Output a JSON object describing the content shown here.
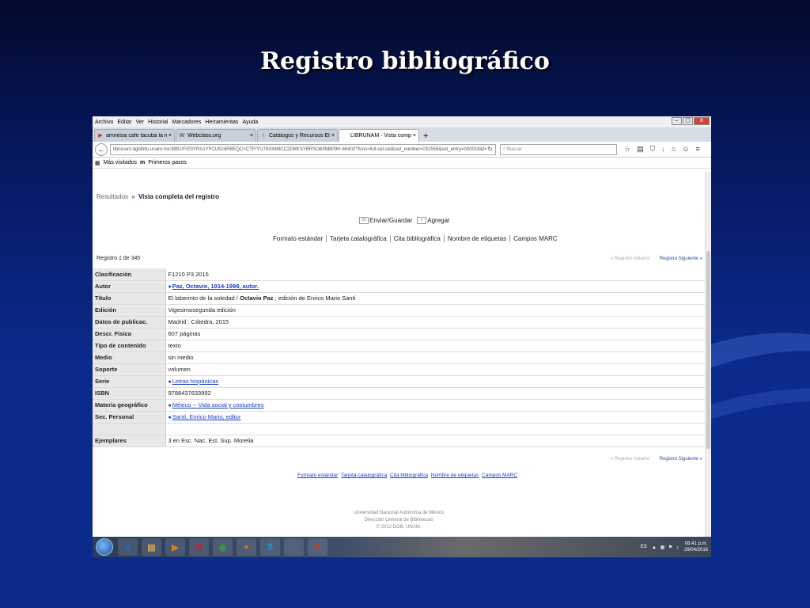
{
  "slide": {
    "title": "Registro bibliográfico"
  },
  "window": {
    "menu": [
      "Archivo",
      "Editar",
      "Ver",
      "Historial",
      "Marcadores",
      "Herramientas",
      "Ayuda"
    ],
    "controls": {
      "minimize": "–",
      "restore": "▢",
      "close": "X"
    }
  },
  "tabs": [
    {
      "icon": "▶",
      "label": "amnesia cafe tacuba la mal...",
      "close": "×",
      "color": "#d62b1f"
    },
    {
      "icon": "W",
      "label": "Webclass.org",
      "close": "×",
      "color": "#333333"
    },
    {
      "icon": "i",
      "label": "Catálogos y Recursos Elect...",
      "close": "×",
      "color": "#2a62b8"
    },
    {
      "icon": "",
      "label": "LIBRUNAM - Vista completa de...",
      "close": "×",
      "color": "#333333"
    }
  ],
  "newtab": "+",
  "nav": {
    "back": "←",
    "url": "librunam.dgbiblio.unam.mx:8991/F/P3YRA1YFCU524RBEQC<CTF/YU78XINMCC2DRKSYBRSO63NBP9H-46402?func=full-set-set&set_number=032558&set_entry=000018&f=",
    "reload": "↻",
    "search_placeholder": "Buscar",
    "icons": [
      "☆",
      "▤",
      "⛉",
      "↓",
      "⌂",
      "☺",
      "≡"
    ]
  },
  "bookmarks": {
    "visited": "Más visitados",
    "first": "Primeros pasos"
  },
  "page": {
    "breadcrumb": {
      "results": "Resultados",
      "sep": "»",
      "current": "Vista completa del registro"
    },
    "actions": {
      "send": "Enviar/Guardar",
      "add": "Agregar"
    },
    "formats": [
      "Formato estándar",
      "Tarjeta catalográfica",
      "Cita bibliográfica",
      "Nombre de etiquetas",
      "Campos MARC"
    ],
    "record_count": "Registro 1 de 345",
    "prev_label": "Registro Anterior",
    "next_label": "Registro Siguiente",
    "records": [
      {
        "key": "Clasificación",
        "value": "F1210 P3 2015"
      },
      {
        "key": "Autor",
        "value": "Paz, Octavio, 1914-1998, autor.",
        "link": true,
        "bold": true,
        "dot": true
      },
      {
        "key": "Título",
        "value_pre": "El laberinto de la soledad / ",
        "value_bold": "Octavio Paz",
        "value_post": " ; edición de Enrico Mario Santí"
      },
      {
        "key": "Edición",
        "value": "Vigesimosegunda edición"
      },
      {
        "key": "Datos de publicac.",
        "value": "Madrid : Cátedra, 2015"
      },
      {
        "key": "Descr. Física",
        "value": "607 páginas"
      },
      {
        "key": "Tipo de contenido",
        "value": "texto"
      },
      {
        "key": "Medio",
        "value": "sin medio"
      },
      {
        "key": "Soporte",
        "value": "volumen"
      },
      {
        "key": "Serie",
        "value": "Letras hispánicas",
        "link": true,
        "dot": true
      },
      {
        "key": "ISBN",
        "value": "9788437633992"
      },
      {
        "key": "Materia geográfico",
        "value": "México -- Vida social y costumbres",
        "link": true,
        "dot": true
      },
      {
        "key": "Sec. Personal",
        "value": "Santí, Enrico Mario, editor",
        "link": true,
        "dot": true
      },
      {
        "key": "",
        "value": ""
      },
      {
        "key": "Ejemplares",
        "value": "3 en  Esc. Nac. Est. Sup. Morelia"
      }
    ],
    "bottom_links": [
      "Formato estándar",
      "Tarjeta catalográfica",
      "Cita bibliográfica",
      "Nombre de etiquetas",
      "Campos MARC"
    ],
    "footer": [
      "Universidad Nacional Autónoma de México",
      "Dirección General de Bibliotecas",
      "© 2012 DGB, UNAM."
    ]
  },
  "taskbar": {
    "apps": [
      {
        "name": "ie-icon",
        "glyph": "e",
        "color": "#1a6fd6"
      },
      {
        "name": "file-explorer-icon",
        "glyph": "▤",
        "color": "#d9a640"
      },
      {
        "name": "media-player-icon",
        "glyph": "▶",
        "color": "#e07a20"
      },
      {
        "name": "opera-icon",
        "glyph": "O",
        "color": "#d3191b"
      },
      {
        "name": "chrome-icon",
        "glyph": "◉",
        "color": "#3c9a3c"
      },
      {
        "name": "firefox-icon",
        "glyph": "●",
        "color": "#e66a1a"
      },
      {
        "name": "skype-icon",
        "glyph": "S",
        "color": "#1a9bd8"
      },
      {
        "name": "user-icon",
        "glyph": "☺",
        "color": "#4a6fa0"
      },
      {
        "name": "powerpoint-icon",
        "glyph": "P",
        "color": "#c9401c"
      }
    ],
    "lang": "ES",
    "time": "08:41 p.m.",
    "date": "29/04/2016"
  }
}
